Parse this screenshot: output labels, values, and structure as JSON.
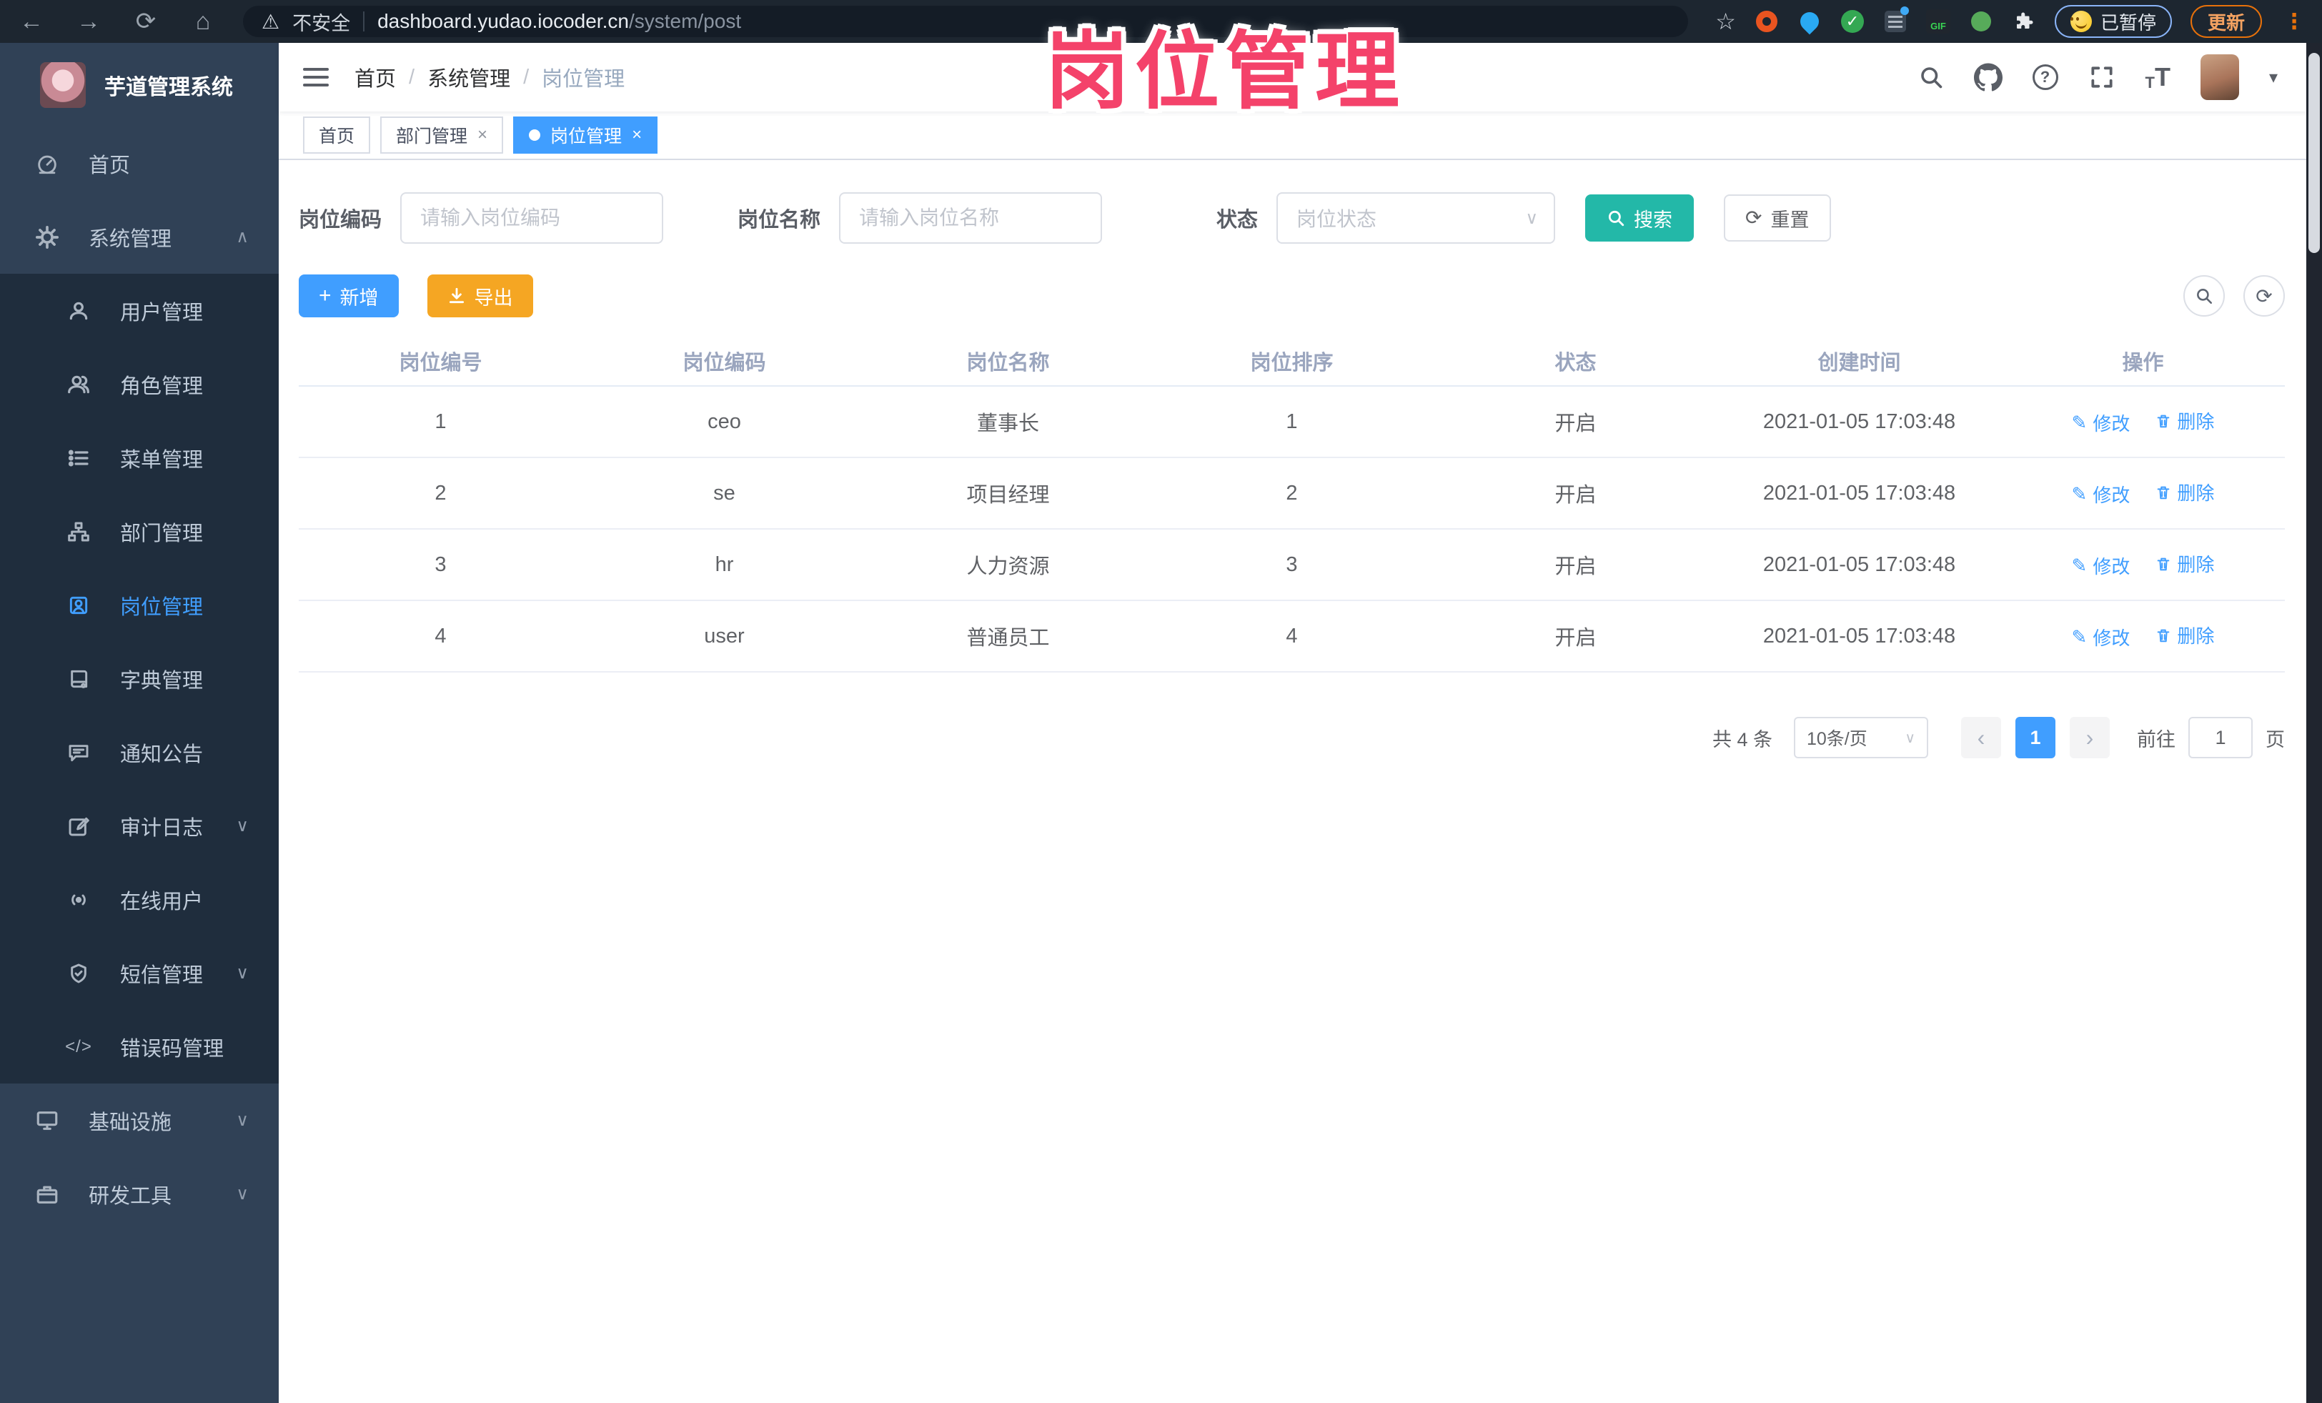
{
  "watermark": "岗位管理",
  "browser": {
    "security_label": "不安全",
    "url_domain": "dashboard.yudao.iocoder.cn",
    "url_path": "/system/post",
    "gif_label": "GIF",
    "paused_label": "已暂停",
    "update_label": "更新"
  },
  "icons": {
    "back": "←",
    "forward": "→",
    "reload": "⟳",
    "home": "⌂",
    "star": "☆",
    "warning": "⚠",
    "dots": "⋮",
    "close": "×",
    "plus": "+",
    "slash": "/",
    "caret_down": "▾",
    "chevron_up": "∧",
    "chevron_down": "∨",
    "prev": "‹",
    "next": "›",
    "question": "?",
    "check": "✓",
    "code": "</>",
    "refresh": "⟳",
    "edit_pencil": "✎",
    "t_small": "T",
    "t_large": "T"
  },
  "sidebar": {
    "title": "芋道管理系统",
    "items": [
      {
        "label": "首页",
        "icon": "dashboard-icon"
      },
      {
        "label": "系统管理",
        "icon": "gear-icon",
        "expanded": true
      },
      {
        "label": "用户管理",
        "icon": "user-icon",
        "sub": true
      },
      {
        "label": "角色管理",
        "icon": "roles-icon",
        "sub": true
      },
      {
        "label": "菜单管理",
        "icon": "menu-list-icon",
        "sub": true
      },
      {
        "label": "部门管理",
        "icon": "org-tree-icon",
        "sub": true
      },
      {
        "label": "岗位管理",
        "icon": "badge-icon",
        "sub": true,
        "active": true
      },
      {
        "label": "字典管理",
        "icon": "dictionary-icon",
        "sub": true
      },
      {
        "label": "通知公告",
        "icon": "announcement-icon",
        "sub": true
      },
      {
        "label": "审计日志",
        "icon": "audit-log-icon",
        "sub": true,
        "collapsible": true
      },
      {
        "label": "在线用户",
        "icon": "online-users-icon",
        "sub": true
      },
      {
        "label": "短信管理",
        "icon": "sms-icon",
        "sub": true,
        "collapsible": true
      },
      {
        "label": "错误码管理",
        "icon": "error-code-icon",
        "sub": true
      },
      {
        "label": "基础设施",
        "icon": "infrastructure-icon",
        "collapsible": true
      },
      {
        "label": "研发工具",
        "icon": "dev-tools-icon",
        "collapsible": true
      }
    ]
  },
  "navbar": {
    "breadcrumb": [
      "首页",
      "系统管理",
      "岗位管理"
    ]
  },
  "tabs": [
    {
      "label": "首页"
    },
    {
      "label": "部门管理",
      "closable": true
    },
    {
      "label": "岗位管理",
      "closable": true,
      "active": true
    }
  ],
  "filters": {
    "post_code": {
      "label": "岗位编码",
      "placeholder": "请输入岗位编码",
      "value": ""
    },
    "post_name": {
      "label": "岗位名称",
      "placeholder": "请输入岗位名称",
      "value": ""
    },
    "status": {
      "label": "状态",
      "placeholder": "岗位状态",
      "value": ""
    },
    "search_label": "搜索",
    "reset_label": "重置"
  },
  "toolbar": {
    "add_label": "新增",
    "export_label": "导出"
  },
  "table": {
    "headers": [
      "岗位编号",
      "岗位编码",
      "岗位名称",
      "岗位排序",
      "状态",
      "创建时间",
      "操作"
    ],
    "actions": {
      "edit": "修改",
      "delete": "删除"
    },
    "rows": [
      {
        "cells": [
          "1",
          "ceo",
          "董事长",
          "1",
          "开启",
          "2021-01-05 17:03:48"
        ]
      },
      {
        "cells": [
          "2",
          "se",
          "项目经理",
          "2",
          "开启",
          "2021-01-05 17:03:48"
        ]
      },
      {
        "cells": [
          "3",
          "hr",
          "人力资源",
          "3",
          "开启",
          "2021-01-05 17:03:48"
        ]
      },
      {
        "cells": [
          "4",
          "user",
          "普通员工",
          "4",
          "开启",
          "2021-01-05 17:03:48"
        ]
      }
    ]
  },
  "pagination": {
    "total": "共 4 条",
    "page_size": "10条/页",
    "current_page": "1",
    "goto_label": "前往",
    "goto_value": "1",
    "page_unit": "页"
  },
  "colors": {
    "accent_blue": "#409EFF",
    "search_teal": "#23B8A8",
    "export_orange": "#F5A623",
    "watermark_pink": "#F4426A",
    "sidebar_bg": "#304156",
    "submenu_bg": "#1F2D3D",
    "browser_bar_bg": "#1D2630"
  }
}
